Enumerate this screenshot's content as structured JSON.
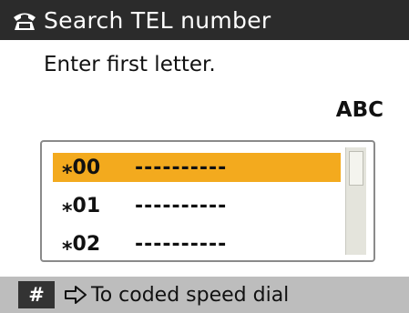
{
  "title_bar": {
    "title": "Search TEL number",
    "icon": "phone-icon"
  },
  "prompt": "Enter first letter.",
  "input_mode": "ABC",
  "entries": [
    {
      "code": "⁎00",
      "name": "----------",
      "selected": true
    },
    {
      "code": "⁎01",
      "name": "----------",
      "selected": false
    },
    {
      "code": "⁎02",
      "name": "----------",
      "selected": false
    }
  ],
  "footer": {
    "key_label": "#",
    "arrow_icon": "arrow-right-icon",
    "action_text": "To coded speed dial"
  },
  "colors": {
    "title_bg": "#2b2b2b",
    "selection": "#f3aa1e",
    "footer_bg": "#bdbdbd"
  }
}
